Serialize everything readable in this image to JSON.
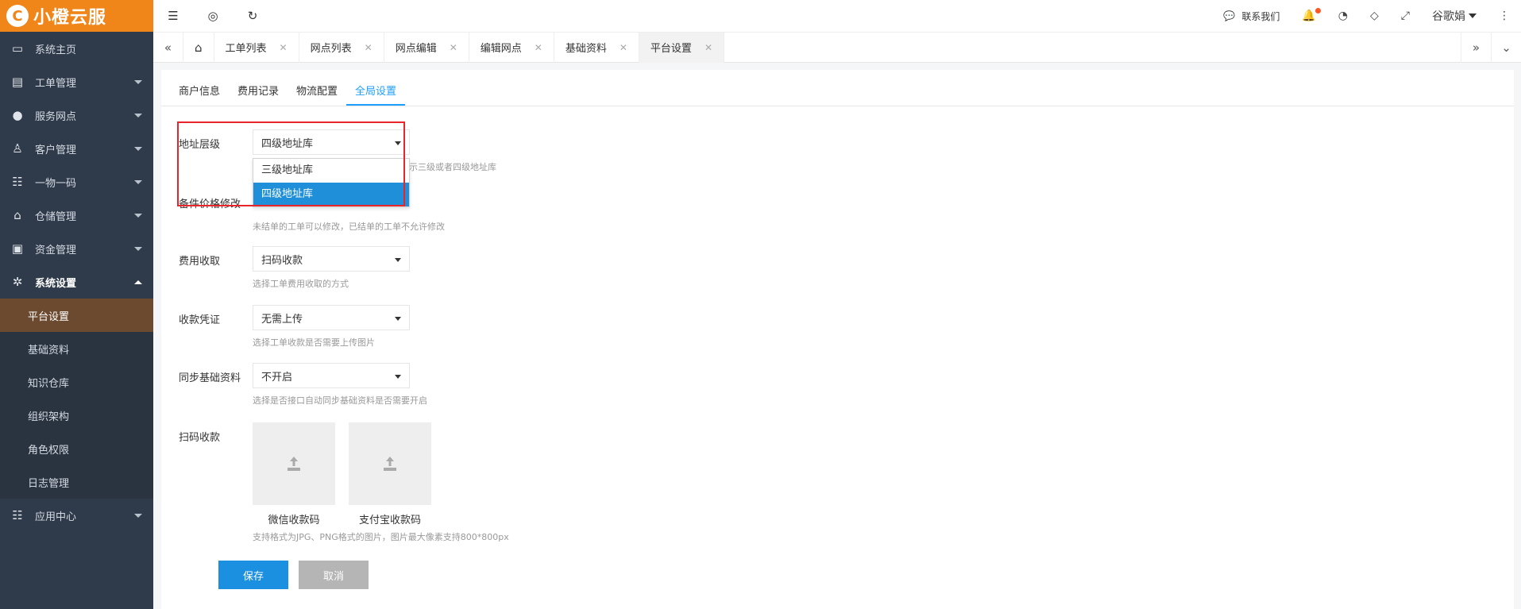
{
  "brand": {
    "logo_char": "C",
    "name": "小橙云服"
  },
  "sidebar": {
    "items": [
      {
        "label": "系统主页",
        "icon": "monitor-icon"
      },
      {
        "label": "工单管理",
        "icon": "document-icon"
      },
      {
        "label": "服务网点",
        "icon": "globe-icon"
      },
      {
        "label": "客户管理",
        "icon": "user-icon"
      },
      {
        "label": "一物一码",
        "icon": "grid-icon"
      },
      {
        "label": "仓储管理",
        "icon": "bank-icon"
      },
      {
        "label": "资金管理",
        "icon": "money-icon"
      },
      {
        "label": "系统设置",
        "icon": "gear-icon"
      }
    ],
    "submenu": [
      "平台设置",
      "基础资料",
      "知识仓库",
      "组织架构",
      "角色权限",
      "日志管理"
    ],
    "last_item": {
      "label": "应用中心",
      "icon": "grid-icon"
    }
  },
  "header": {
    "contact_label": "联系我们",
    "user_name": "谷歌娟"
  },
  "tabs": [
    "工单列表",
    "网点列表",
    "网点编辑",
    "编辑网点",
    "基础资料",
    "平台设置"
  ],
  "subtabs": [
    "商户信息",
    "费用记录",
    "物流配置",
    "全局设置"
  ],
  "form": {
    "address_level": {
      "label": "地址层级",
      "value": "四级地址库",
      "help": "示三级或者四级地址库",
      "options": [
        "三级地址库",
        "四级地址库"
      ]
    },
    "price_edit": {
      "label": "备件价格修改",
      "help": "未结单的工单可以修改，已结单的工单不允许修改"
    },
    "fee_collect": {
      "label": "费用收取",
      "value": "扫码收款",
      "help": "选择工单费用收取的方式"
    },
    "voucher": {
      "label": "收款凭证",
      "value": "无需上传",
      "help": "选择工单收款是否需要上传图片"
    },
    "sync": {
      "label": "同步基础资料",
      "value": "不开启",
      "help": "选择是否接口自动同步基础资料是否需要开启"
    },
    "qr": {
      "label": "扫码收款",
      "wechat": "微信收款码",
      "alipay": "支付宝收款码",
      "help": "支持格式为JPG、PNG格式的图片，图片最大像素支持800*800px"
    }
  },
  "buttons": {
    "save": "保存",
    "cancel": "取消"
  },
  "colors": {
    "brand": "#f08519",
    "accent": "#1e9fff",
    "highlight": "#e8252b"
  }
}
